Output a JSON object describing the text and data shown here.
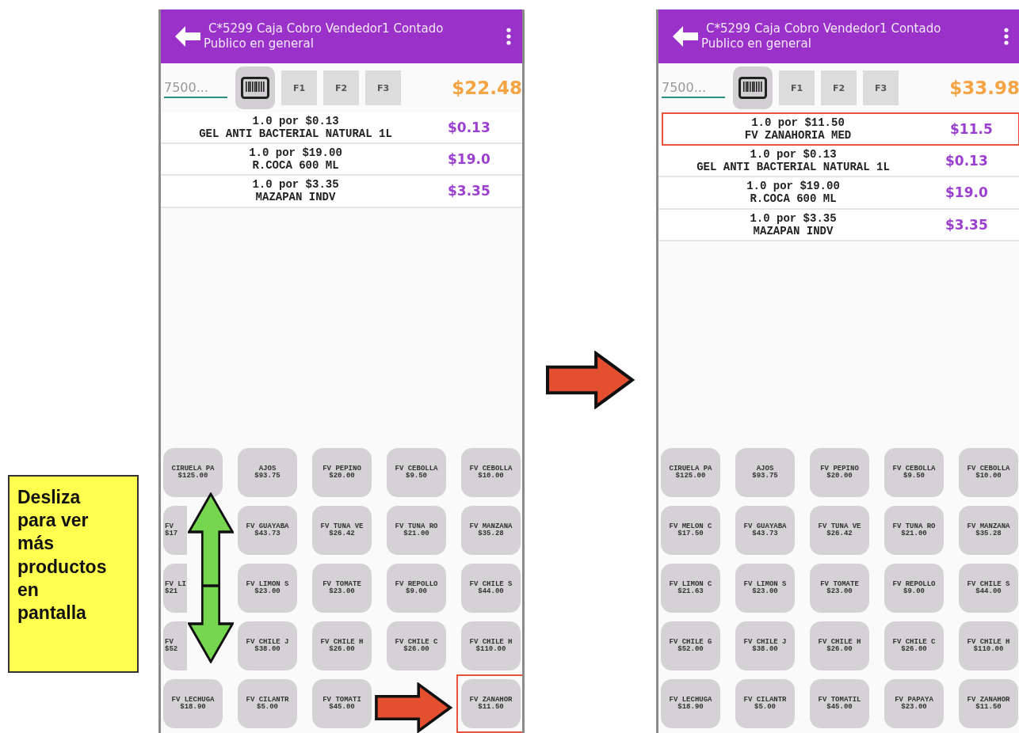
{
  "instruction_note": "Desliza\npara ver\nmás\nproductos\nen\npantalla",
  "screens": [
    {
      "header": {
        "title": "C*5299 Caja Cobro Vendedor1 Contado",
        "subtitle": "Publico en general"
      },
      "code_field": {
        "placeholder": "7500..."
      },
      "function_keys": [
        "F1",
        "F2",
        "F3"
      ],
      "total": "$22.48",
      "cart": [
        {
          "quantity_line": "1.0 por $0.13",
          "name": "GEL ANTI BACTERIAL NATURAL 1L",
          "amount": "$0.13",
          "highlighted": false
        },
        {
          "quantity_line": "1.0 por $19.00",
          "name": "R.COCA 600 ML",
          "amount": "$19.0",
          "highlighted": false
        },
        {
          "quantity_line": "1.0 por $3.35",
          "name": "MAZAPAN INDV",
          "amount": "$3.35",
          "highlighted": false
        }
      ],
      "products": [
        {
          "kind": "full",
          "name": "CIRUELA PA",
          "price": "$125.00",
          "highlighted": false
        },
        {
          "kind": "full",
          "name": "AJOS",
          "price": "$93.75",
          "highlighted": false
        },
        {
          "kind": "full",
          "name": "FV PEPINO",
          "price": "$20.00",
          "highlighted": false
        },
        {
          "kind": "full",
          "name": "FV CEBOLLA",
          "price": "$9.50",
          "highlighted": false
        },
        {
          "kind": "full",
          "name": "FV CEBOLLA",
          "price": "$10.00",
          "highlighted": false
        },
        {
          "kind": "covered",
          "name": "FV",
          "price": "$17",
          "highlighted": false
        },
        {
          "kind": "full",
          "name": "FV GUAYABA",
          "price": "$43.73",
          "highlighted": false
        },
        {
          "kind": "full",
          "name": "FV TUNA VE",
          "price": "$26.42",
          "highlighted": false
        },
        {
          "kind": "full",
          "name": "FV TUNA RO",
          "price": "$21.00",
          "highlighted": false
        },
        {
          "kind": "full",
          "name": "FV MANZANA",
          "price": "$35.28",
          "highlighted": false
        },
        {
          "kind": "covered",
          "name": "FV LI",
          "price": "$21",
          "highlighted": false
        },
        {
          "kind": "full",
          "name": "FV LIMON S",
          "price": "$23.00",
          "highlighted": false
        },
        {
          "kind": "full",
          "name": "FV TOMATE",
          "price": "$23.00",
          "highlighted": false
        },
        {
          "kind": "full",
          "name": "FV REPOLLO",
          "price": "$9.00",
          "highlighted": false
        },
        {
          "kind": "full",
          "name": "FV CHILE S",
          "price": "$44.00",
          "highlighted": false
        },
        {
          "kind": "covered",
          "name": "FV",
          "price": "$52",
          "highlighted": false
        },
        {
          "kind": "full",
          "name": "FV CHILE J",
          "price": "$38.00",
          "highlighted": false
        },
        {
          "kind": "full",
          "name": "FV CHILE H",
          "price": "$26.00",
          "highlighted": false
        },
        {
          "kind": "full",
          "name": "FV CHILE C",
          "price": "$26.00",
          "highlighted": false
        },
        {
          "kind": "full",
          "name": "FV CHILE H",
          "price": "$110.00",
          "highlighted": false
        },
        {
          "kind": "full",
          "name": "FV LECHUGA",
          "price": "$18.90",
          "highlighted": false
        },
        {
          "kind": "full",
          "name": "FV CILANTR",
          "price": "$5.00",
          "highlighted": false
        },
        {
          "kind": "full",
          "name": "FV TOMATI",
          "price": "$45.00",
          "highlighted": false
        },
        {
          "kind": "hidden"
        },
        {
          "kind": "full",
          "name": "FV ZANAHOR",
          "price": "$11.50",
          "highlighted": true
        }
      ],
      "scroll_hint": true,
      "tap_hint": true
    },
    {
      "header": {
        "title": "C*5299 Caja Cobro Vendedor1 Contado",
        "subtitle": "Publico en general"
      },
      "code_field": {
        "placeholder": "7500..."
      },
      "function_keys": [
        "F1",
        "F2",
        "F3"
      ],
      "total": "$33.98",
      "cart": [
        {
          "quantity_line": "1.0 por $11.50",
          "name": "FV ZANAHORIA MED",
          "amount": "$11.5",
          "highlighted": true
        },
        {
          "quantity_line": "1.0 por $0.13",
          "name": "GEL ANTI BACTERIAL NATURAL 1L",
          "amount": "$0.13",
          "highlighted": false
        },
        {
          "quantity_line": "1.0 por $19.00",
          "name": "R.COCA 600 ML",
          "amount": "$19.0",
          "highlighted": false
        },
        {
          "quantity_line": "1.0 por $3.35",
          "name": "MAZAPAN INDV",
          "amount": "$3.35",
          "highlighted": false
        }
      ],
      "products": [
        {
          "kind": "full",
          "name": "CIRUELA PA",
          "price": "$125.00",
          "highlighted": false
        },
        {
          "kind": "full",
          "name": "AJOS",
          "price": "$93.75",
          "highlighted": false
        },
        {
          "kind": "full",
          "name": "FV PEPINO",
          "price": "$20.00",
          "highlighted": false
        },
        {
          "kind": "full",
          "name": "FV CEBOLLA",
          "price": "$9.50",
          "highlighted": false
        },
        {
          "kind": "full",
          "name": "FV CEBOLLA",
          "price": "$10.00",
          "highlighted": false
        },
        {
          "kind": "full",
          "name": "FV MELON C",
          "price": "$17.50",
          "highlighted": false
        },
        {
          "kind": "full",
          "name": "FV GUAYABA",
          "price": "$43.73",
          "highlighted": false
        },
        {
          "kind": "full",
          "name": "FV TUNA VE",
          "price": "$26.42",
          "highlighted": false
        },
        {
          "kind": "full",
          "name": "FV TUNA RO",
          "price": "$21.00",
          "highlighted": false
        },
        {
          "kind": "full",
          "name": "FV MANZANA",
          "price": "$35.28",
          "highlighted": false
        },
        {
          "kind": "full",
          "name": "FV LIMON C",
          "price": "$21.63",
          "highlighted": false
        },
        {
          "kind": "full",
          "name": "FV LIMON S",
          "price": "$23.00",
          "highlighted": false
        },
        {
          "kind": "full",
          "name": "FV TOMATE",
          "price": "$23.00",
          "highlighted": false
        },
        {
          "kind": "full",
          "name": "FV REPOLLO",
          "price": "$9.00",
          "highlighted": false
        },
        {
          "kind": "full",
          "name": "FV CHILE S",
          "price": "$44.00",
          "highlighted": false
        },
        {
          "kind": "full",
          "name": "FV CHILE G",
          "price": "$52.00",
          "highlighted": false
        },
        {
          "kind": "full",
          "name": "FV CHILE J",
          "price": "$38.00",
          "highlighted": false
        },
        {
          "kind": "full",
          "name": "FV CHILE H",
          "price": "$26.00",
          "highlighted": false
        },
        {
          "kind": "full",
          "name": "FV CHILE C",
          "price": "$26.00",
          "highlighted": false
        },
        {
          "kind": "full",
          "name": "FV CHILE H",
          "price": "$110.00",
          "highlighted": false
        },
        {
          "kind": "full",
          "name": "FV LECHUGA",
          "price": "$18.90",
          "highlighted": false
        },
        {
          "kind": "full",
          "name": "FV CILANTR",
          "price": "$5.00",
          "highlighted": false
        },
        {
          "kind": "full",
          "name": "FV TOMATIL",
          "price": "$45.00",
          "highlighted": false
        },
        {
          "kind": "full",
          "name": "FV PAPAYA",
          "price": "$23.00",
          "highlighted": false
        },
        {
          "kind": "full",
          "name": "FV ZANAHOR",
          "price": "$11.50",
          "highlighted": false
        }
      ]
    }
  ],
  "between_arrow": {
    "kind": "right-arrow"
  }
}
